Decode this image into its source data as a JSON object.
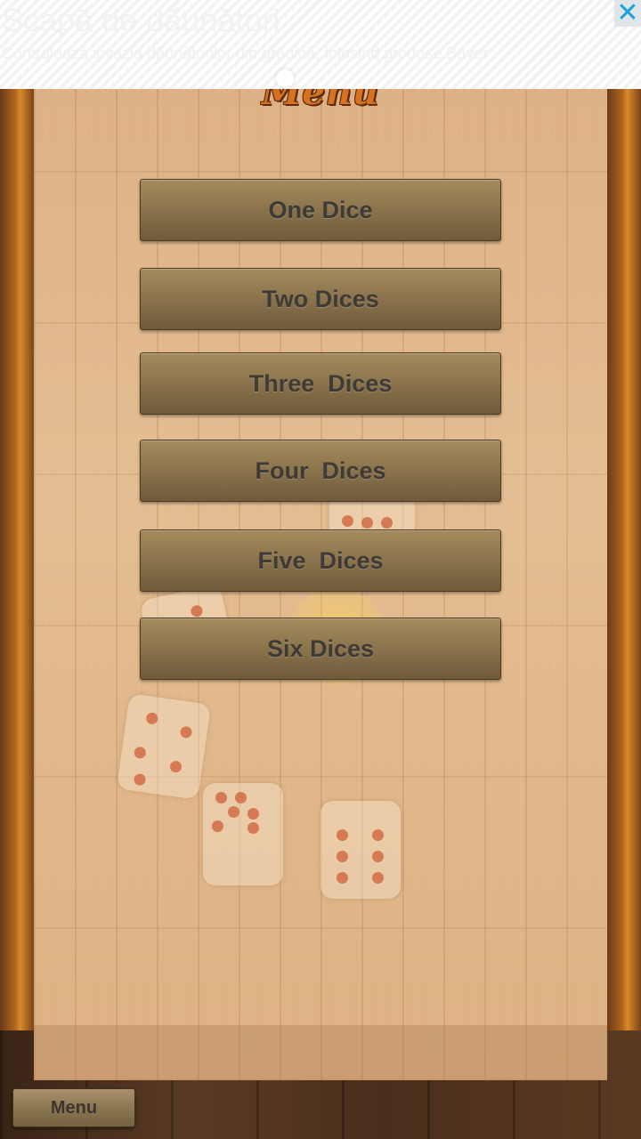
{
  "ad": {
    "title": "Scapă de dăunători",
    "body": "Controlează invazia dăunătorilor din grădină, folosind produse Bayer",
    "close_icon": "close-icon",
    "accent_color": "#1aa1d6"
  },
  "panel": {
    "title": "Menu"
  },
  "menu": {
    "items": [
      {
        "label": "One Dice"
      },
      {
        "label": "Two Dices"
      },
      {
        "label": "Three  Dices"
      },
      {
        "label": "Four  Dices"
      },
      {
        "label": "Five  Dices"
      },
      {
        "label": "Six Dices"
      }
    ]
  },
  "bottom_bar": {
    "menu_label": "Menu"
  }
}
